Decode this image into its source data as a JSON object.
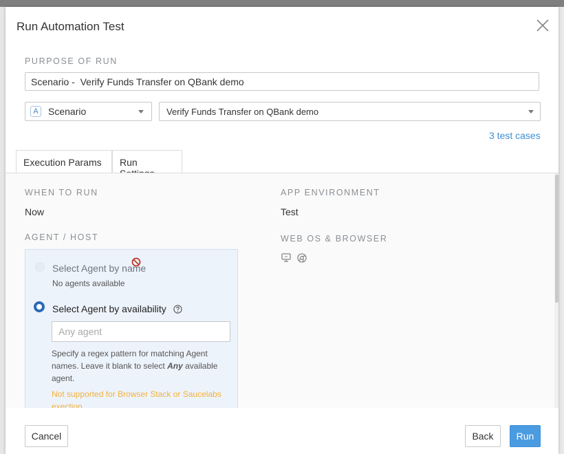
{
  "dialog": {
    "title": "Run Automation Test",
    "close_icon": "close-icon"
  },
  "purpose": {
    "label": "Purpose of Run",
    "value": "Scenario -  Verify Funds Transfer on QBank demo"
  },
  "type_select": {
    "badge": "A",
    "value": "Scenario"
  },
  "target_select": {
    "value": "Verify Funds Transfer on QBank demo"
  },
  "test_cases_link": "3 test cases",
  "tabs": [
    {
      "label": "Execution Params",
      "active": false
    },
    {
      "label": "Run Settings",
      "active": true
    }
  ],
  "run_settings": {
    "when_label": "When to Run",
    "when_value": "Now",
    "agent_label": "Agent / Host",
    "env_label": "App Environment",
    "env_value": "Test",
    "os_label": "Web OS & Browser",
    "os_icons": [
      "monitor-icon",
      "chrome-icon"
    ],
    "agent": {
      "option_name": "Select Agent by name",
      "no_agents": "No agents available",
      "option_availability": "Select Agent by availability",
      "selected": "availability",
      "input_placeholder": "Any agent",
      "hint_before": "Specify a regex pattern for matching Agent names. Leave it blank to select ",
      "hint_em": "Any",
      "hint_after": " available agent.",
      "warning": "Not supported for Browser Stack or Saucelabs exection"
    }
  },
  "footer": {
    "cancel": "Cancel",
    "back": "Back",
    "run": "Run"
  },
  "colors": {
    "accent": "#4a9be0",
    "link": "#3f8fd0",
    "warning": "#f3b13b",
    "radio_selected": "#2a6ab8"
  }
}
